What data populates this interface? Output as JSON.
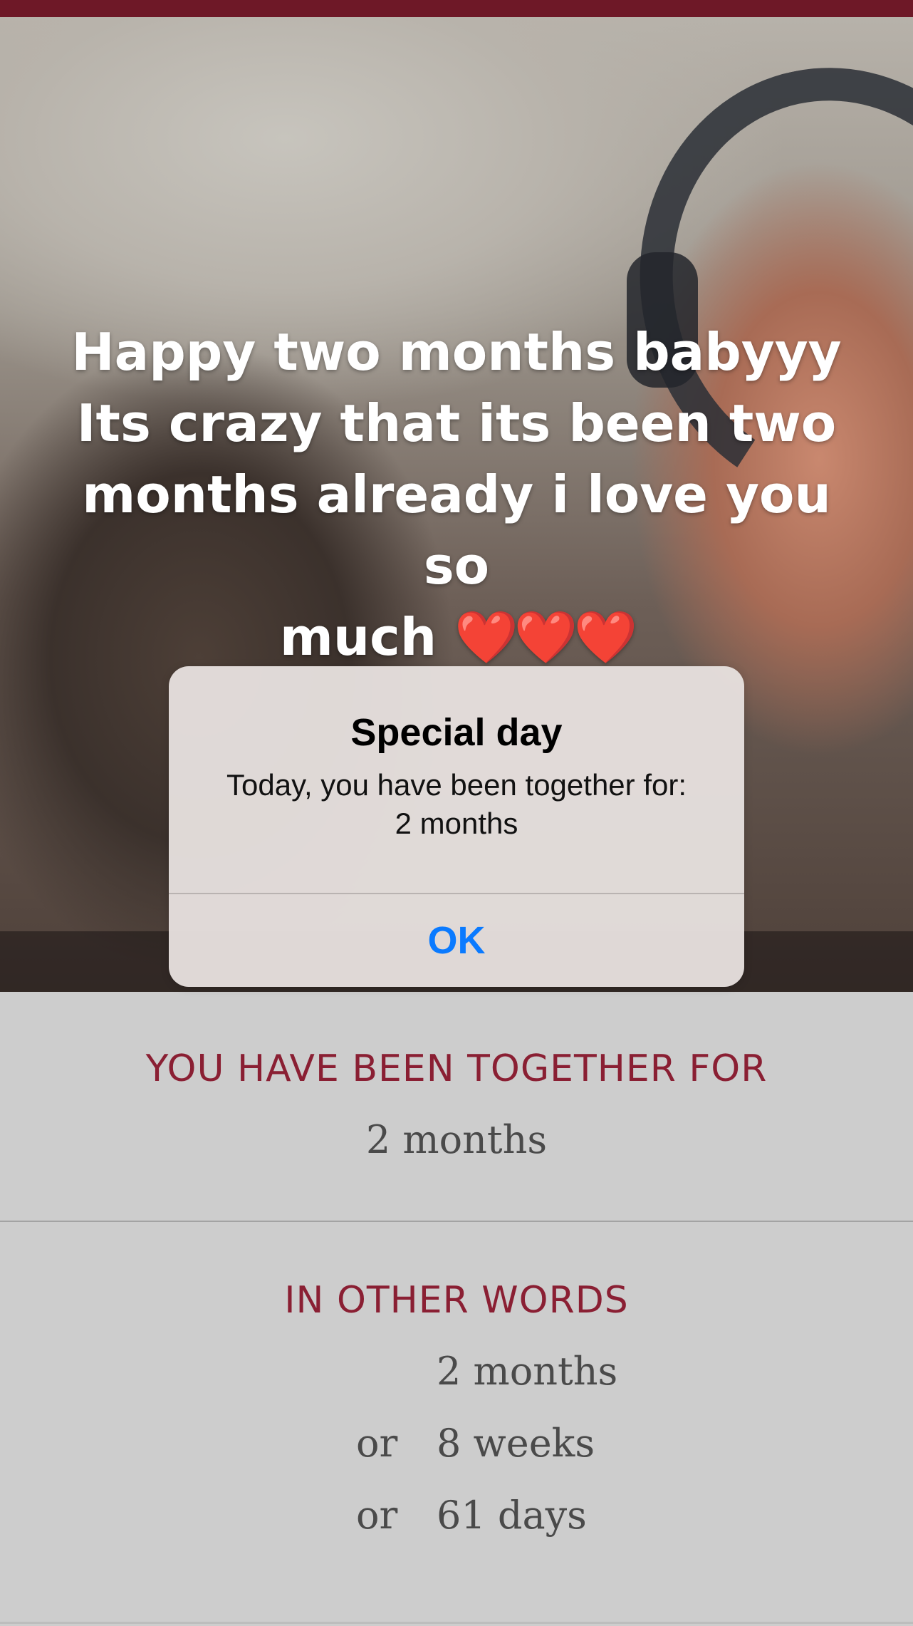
{
  "photo": {
    "caption_lines": [
      "Happy two months babyyy",
      "Its crazy that its been two",
      "months already i love you so",
      "much"
    ],
    "caption_hearts": "❤️❤️❤️"
  },
  "alert": {
    "title": "Special day",
    "message": "Today, you have been together for:",
    "value": "2 months",
    "ok_label": "OK",
    "ok_color": "#0a7aff"
  },
  "together": {
    "heading": "YOU HAVE BEEN TOGETHER FOR",
    "value": "2 months"
  },
  "other_words": {
    "heading": "IN OTHER WORDS",
    "rows": [
      {
        "prefix": "",
        "value": "2 months"
      },
      {
        "prefix": "or",
        "value": "8 weeks"
      },
      {
        "prefix": "or",
        "value": "61 days"
      }
    ]
  },
  "colors": {
    "accent": "#8a1f33",
    "top_bar": "#6e1827",
    "background": "#cdcdcd"
  }
}
